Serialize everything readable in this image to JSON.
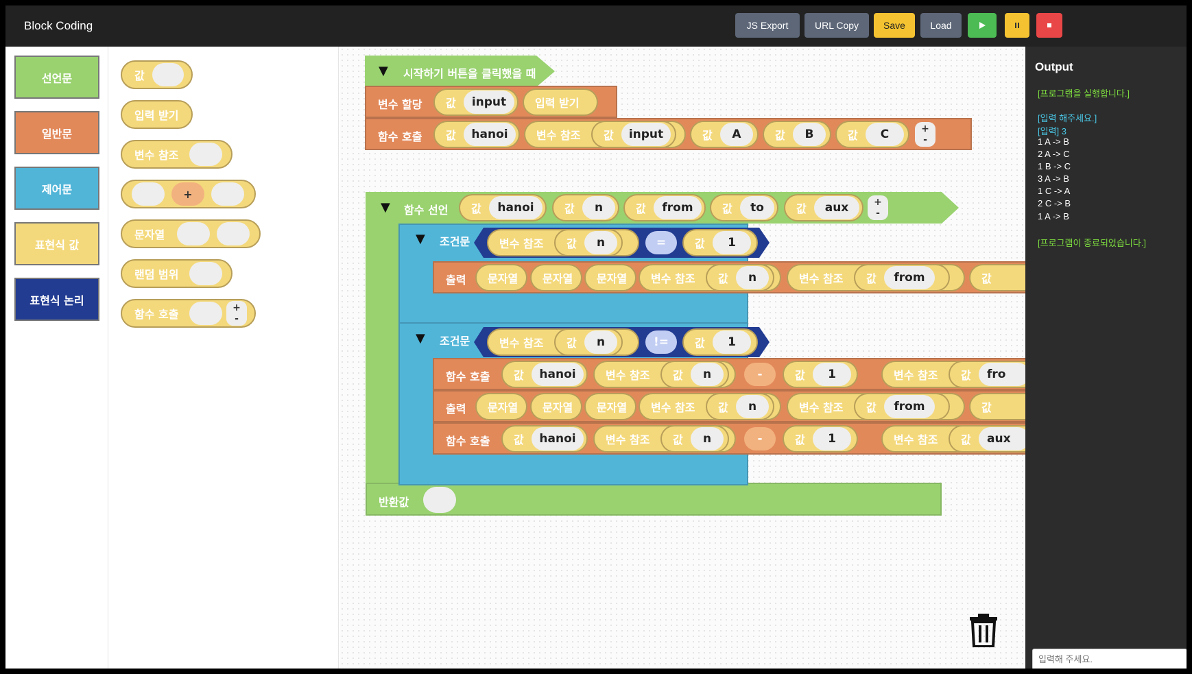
{
  "app": {
    "title": "Block Coding"
  },
  "toolbar": {
    "js_export": "JS Export",
    "url_copy": "URL Copy",
    "save": "Save",
    "load": "Load",
    "run_icon": "play-icon",
    "pause_icon": "pause-icon",
    "stop_icon": "stop-icon"
  },
  "categories": [
    {
      "label": "선언문",
      "color": "#99d26f"
    },
    {
      "label": "일반문",
      "color": "#e2895a"
    },
    {
      "label": "제어문",
      "color": "#51b5d8"
    },
    {
      "label": "표현식 값",
      "color": "#f4d97c"
    },
    {
      "label": "표현식 논리",
      "color": "#223c92"
    }
  ],
  "palette": {
    "value": "값",
    "input": "입력 받기",
    "var_ref": "변수 참조",
    "plus": "+",
    "string": "문자열",
    "random": "랜덤 범위",
    "func_call": "함수 호출",
    "pm_plus": "+",
    "pm_minus": "-"
  },
  "workspace": {
    "start_event": "시작하기 버튼을 클릭했을 때",
    "var_assign": "변수 할당",
    "func_call": "함수 호출",
    "func_decl": "함수 선언",
    "cond": "조건문",
    "print": "출력",
    "ret": "반환값",
    "value": "값",
    "var_ref": "변수 참조",
    "input_block": "입력 받기",
    "string": "문자열",
    "toggle": "▼",
    "plus": "+",
    "minus": "-",
    "eq": "=",
    "neq": "!=",
    "v_input": "input",
    "v_hanoi": "hanoi",
    "v_A": "A",
    "v_B": "B",
    "v_C": "C",
    "v_n": "n",
    "v_from": "from",
    "v_to": "to",
    "v_aux": "aux",
    "v_1": "1",
    "v_fro": "fro",
    "v_aux_cut": "aux",
    "trash_icon": "trash-icon"
  },
  "output": {
    "title": "Output",
    "lines": [
      {
        "text": "[프로그램을 실행합니다.]",
        "color": "#7ddc3f"
      },
      {
        "text": "[입력 해주세요.]",
        "color": "#4ac9e8"
      },
      {
        "text": "[입력] 3",
        "color": "#4ac9e8"
      },
      {
        "text": "1 A -> B",
        "color": "#ffffff"
      },
      {
        "text": "2 A -> C",
        "color": "#ffffff"
      },
      {
        "text": "1 B -> C",
        "color": "#ffffff"
      },
      {
        "text": "3 A -> B",
        "color": "#ffffff"
      },
      {
        "text": "1 C -> A",
        "color": "#ffffff"
      },
      {
        "text": "2 C -> B",
        "color": "#ffffff"
      },
      {
        "text": "1 A -> B",
        "color": "#ffffff"
      },
      {
        "text": "[프로그램이 종료되었습니다.]",
        "color": "#7ddc3f"
      }
    ],
    "input_placeholder": "입력해 주세요."
  }
}
